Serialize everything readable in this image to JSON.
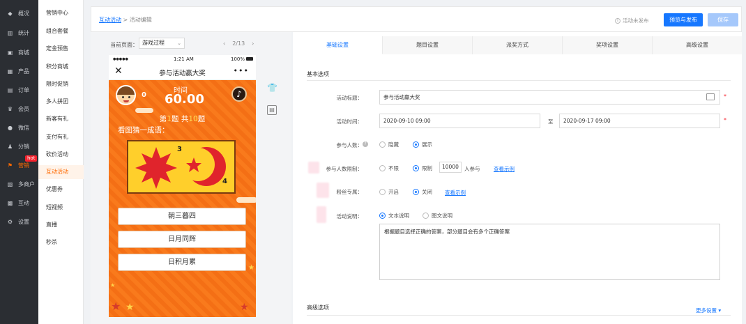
{
  "nav": {
    "items": [
      {
        "label": "概况",
        "icon": "dashboard-icon",
        "glyph": "◆"
      },
      {
        "label": "统计",
        "icon": "stats-icon",
        "glyph": "▥"
      },
      {
        "label": "商城",
        "icon": "mall-icon",
        "glyph": "▣"
      },
      {
        "label": "产品",
        "icon": "product-icon",
        "glyph": "▦"
      },
      {
        "label": "订单",
        "icon": "order-icon",
        "glyph": "▤"
      },
      {
        "label": "会员",
        "icon": "crown-icon",
        "glyph": "♛"
      },
      {
        "label": "微信",
        "icon": "wechat-icon",
        "glyph": "●"
      },
      {
        "label": "分销",
        "icon": "distribution-icon",
        "glyph": "♟"
      },
      {
        "label": "营销",
        "icon": "flag-icon",
        "glyph": "⚑",
        "badge": "hot"
      },
      {
        "label": "多商户",
        "icon": "merchants-icon",
        "glyph": "▧"
      },
      {
        "label": "互动",
        "icon": "interact-icon",
        "glyph": "▩"
      },
      {
        "label": "设置",
        "icon": "gear-icon",
        "glyph": "⚙"
      }
    ],
    "active_index": 8
  },
  "submenu": {
    "items": [
      "营销中心",
      "组合套餐",
      "定金预售",
      "积分商城",
      "限时促销",
      "多人拼团",
      "新客有礼",
      "支付有礼",
      "砍价活动",
      "互动活动",
      "优惠券",
      "短视频",
      "直播",
      "秒杀"
    ],
    "active_index": 9
  },
  "header": {
    "crumb_link": "互动活动",
    "crumb_sep": ">",
    "crumb_current": "活动编辑",
    "status_text": "活动未发布",
    "publish_label": "预览与发布",
    "save_label": "保存",
    "colors": {
      "primary": "#1677ff",
      "primary_disabled": "#a5c8fb"
    }
  },
  "preview": {
    "current_page_label": "当前页面：",
    "page_select_value": "游戏过程",
    "pager_prev": "‹",
    "pager_text": "2/13",
    "pager_next": "›",
    "phone": {
      "status_left": "●●●●●",
      "status_time": "1:21 AM",
      "status_battery": "100%",
      "title": "参与活动赢大奖",
      "close": "✕",
      "more": "•••",
      "score": "0",
      "timer_label": "时间",
      "timer_value": "60.00",
      "question_prefix": "第",
      "question_no": "1",
      "question_mid": "题 共",
      "question_total": "10",
      "question_suffix": "题",
      "prompt": "看图猜一成语：",
      "picture_num_1": "3",
      "picture_num_2": "4",
      "answers": [
        "朝三暮四",
        "日月同辉",
        "日积月累"
      ]
    },
    "side_tools": [
      {
        "name": "shirt-icon",
        "glyph": "👕"
      },
      {
        "name": "document-icon",
        "glyph": "▤"
      }
    ]
  },
  "settings": {
    "tabs": [
      "基础设置",
      "题目设置",
      "派奖方式",
      "奖项设置",
      "高级设置"
    ],
    "active_tab": 0,
    "basic_section_title": "基本选项",
    "fields": {
      "title_label": "活动标题：",
      "title_value": "参与活动赢大奖",
      "time_label": "活动时间：",
      "time_start": "2020-09-10 09:00",
      "time_sep": "至",
      "time_end": "2020-09-17 09:00",
      "participants_label": "参与人数：",
      "participants_options": [
        "隐藏",
        "展示"
      ],
      "participants_selected": 1,
      "limit_label": "参与人数限制：",
      "limit_options": [
        "不限",
        "限制"
      ],
      "limit_selected": 1,
      "limit_value": "10000",
      "limit_unit": "人参与",
      "limit_example_link": "查看示例",
      "fans_label": "粉丝专属：",
      "fans_options": [
        "开启",
        "关闭"
      ],
      "fans_selected": 1,
      "fans_example_link": "查看示例",
      "desc_label": "活动说明：",
      "desc_options": [
        "文本说明",
        "图文说明"
      ],
      "desc_selected": 0,
      "desc_text": "根据题目选择正确的答案，部分题目会有多个正确答案"
    },
    "advanced_section_title": "高级选项",
    "more_settings_label": "更多设置",
    "more_settings_caret": "▾"
  }
}
